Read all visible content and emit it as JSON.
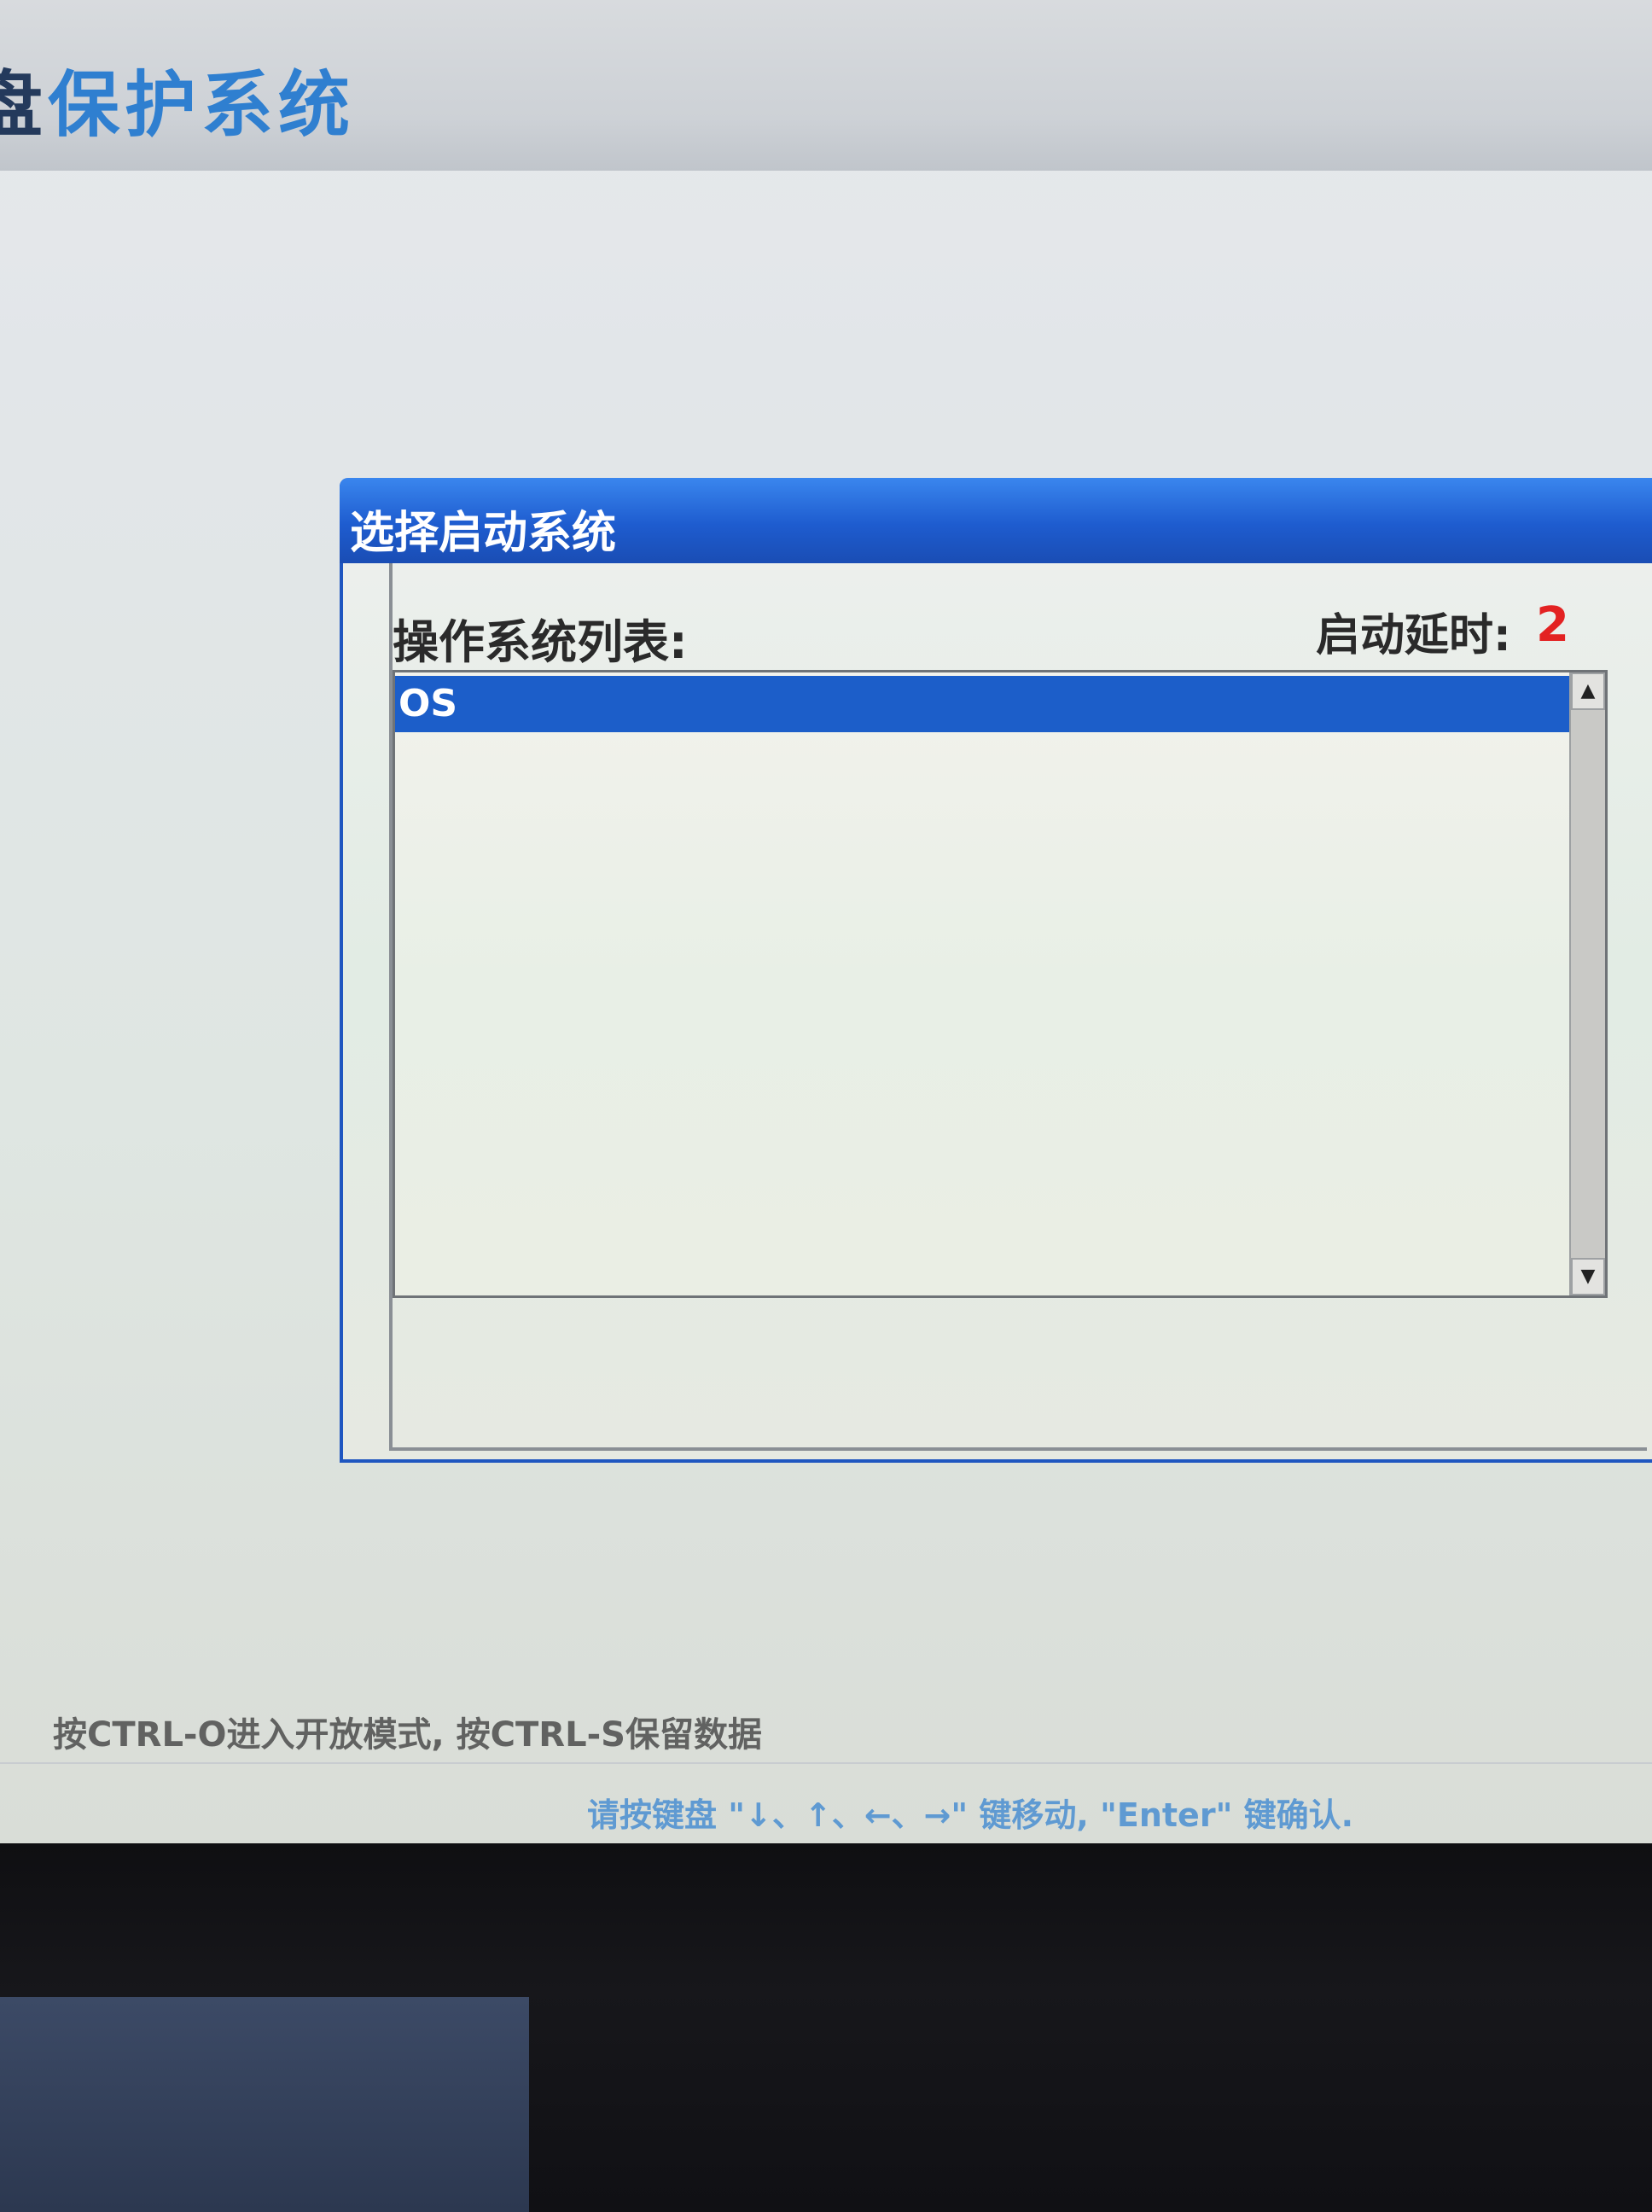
{
  "header": {
    "title_part1": "盘",
    "title_part2": "保护系统"
  },
  "dialog": {
    "title": "选择启动系统",
    "list_label": "操作系统列表:",
    "delay_label": "启动延时:",
    "delay_value": "2",
    "os_list": [
      {
        "label": "OS",
        "selected": true
      }
    ]
  },
  "footer": {
    "shortcut_hint": "按CTRL-O进入开放模式, 按CTRL-S保留数据",
    "nav_hint": "请按键盘 \"↓、↑、←、→\" 键移动, \"Enter\" 键确认."
  },
  "icons": {
    "scroll_up": "scroll-up-arrow-icon",
    "scroll_down": "scroll-down-arrow-icon"
  },
  "colors": {
    "accent_blue": "#1e5ccf",
    "selection_blue": "#1c5ec9",
    "delay_red": "#e32222",
    "title_blue": "#2f7fd0"
  }
}
